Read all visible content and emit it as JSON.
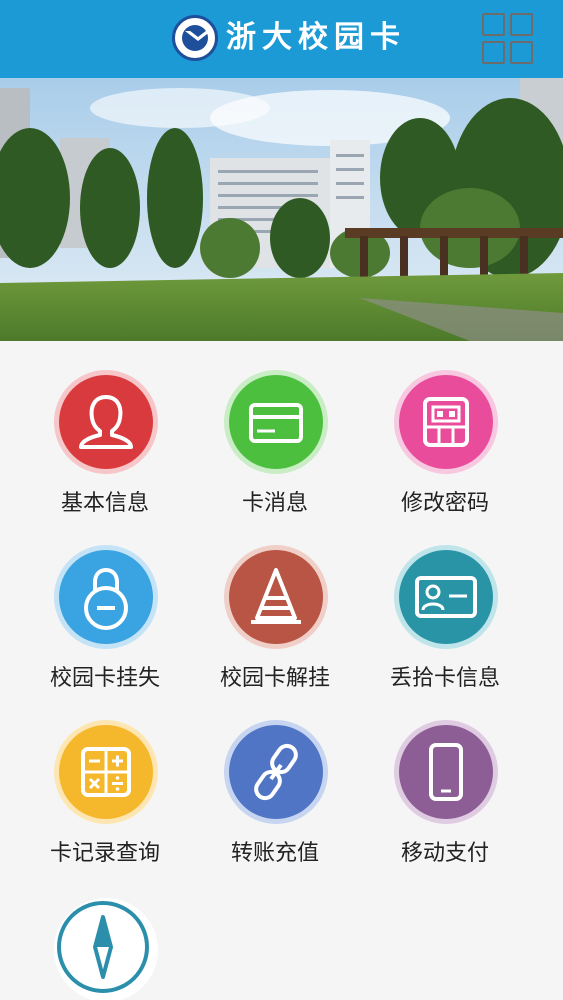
{
  "header": {
    "title": "浙大校园卡",
    "logo_icon": "zju-logo-icon",
    "menu_icon": "grid-menu-icon",
    "bar_color": "#1c9ad6"
  },
  "banner": {
    "slide_count": 3,
    "active_slide": 1
  },
  "menu": {
    "items": [
      {
        "label": "基本信息",
        "icon": "user-icon",
        "color": "#d83a3e"
      },
      {
        "label": "卡消息",
        "icon": "card-icon",
        "color": "#4cbf3f"
      },
      {
        "label": "修改密码",
        "icon": "robot-icon",
        "color": "#e84c9b"
      },
      {
        "label": "校园卡挂失",
        "icon": "lock-icon",
        "color": "#3aa3e1"
      },
      {
        "label": "校园卡解挂",
        "icon": "cone-icon",
        "color": "#b85545"
      },
      {
        "label": "丢拾卡信息",
        "icon": "id-card-icon",
        "color": "#2994a6"
      },
      {
        "label": "卡记录查询",
        "icon": "calculator-icon",
        "color": "#f5b72b"
      },
      {
        "label": "转账充值",
        "icon": "link-icon",
        "color": "#4f75c4"
      },
      {
        "label": "移动支付",
        "icon": "phone-icon",
        "color": "#8d5e95"
      },
      {
        "label": "",
        "icon": "compass-icon",
        "color": "#2b8fab"
      }
    ]
  }
}
